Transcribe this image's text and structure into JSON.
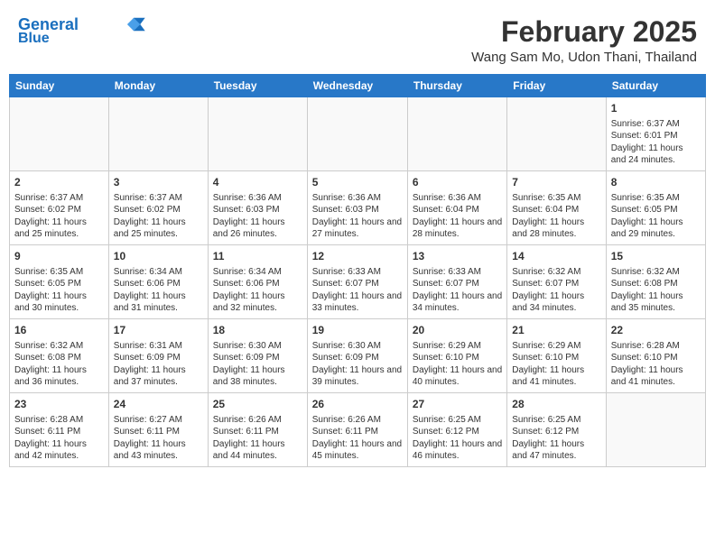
{
  "header": {
    "logo_line1": "General",
    "logo_line2": "Blue",
    "month": "February 2025",
    "location": "Wang Sam Mo, Udon Thani, Thailand"
  },
  "weekdays": [
    "Sunday",
    "Monday",
    "Tuesday",
    "Wednesday",
    "Thursday",
    "Friday",
    "Saturday"
  ],
  "weeks": [
    [
      {
        "day": "",
        "info": ""
      },
      {
        "day": "",
        "info": ""
      },
      {
        "day": "",
        "info": ""
      },
      {
        "day": "",
        "info": ""
      },
      {
        "day": "",
        "info": ""
      },
      {
        "day": "",
        "info": ""
      },
      {
        "day": "1",
        "info": "Sunrise: 6:37 AM\nSunset: 6:01 PM\nDaylight: 11 hours and 24 minutes."
      }
    ],
    [
      {
        "day": "2",
        "info": "Sunrise: 6:37 AM\nSunset: 6:02 PM\nDaylight: 11 hours and 25 minutes."
      },
      {
        "day": "3",
        "info": "Sunrise: 6:37 AM\nSunset: 6:02 PM\nDaylight: 11 hours and 25 minutes."
      },
      {
        "day": "4",
        "info": "Sunrise: 6:36 AM\nSunset: 6:03 PM\nDaylight: 11 hours and 26 minutes."
      },
      {
        "day": "5",
        "info": "Sunrise: 6:36 AM\nSunset: 6:03 PM\nDaylight: 11 hours and 27 minutes."
      },
      {
        "day": "6",
        "info": "Sunrise: 6:36 AM\nSunset: 6:04 PM\nDaylight: 11 hours and 28 minutes."
      },
      {
        "day": "7",
        "info": "Sunrise: 6:35 AM\nSunset: 6:04 PM\nDaylight: 11 hours and 28 minutes."
      },
      {
        "day": "8",
        "info": "Sunrise: 6:35 AM\nSunset: 6:05 PM\nDaylight: 11 hours and 29 minutes."
      }
    ],
    [
      {
        "day": "9",
        "info": "Sunrise: 6:35 AM\nSunset: 6:05 PM\nDaylight: 11 hours and 30 minutes."
      },
      {
        "day": "10",
        "info": "Sunrise: 6:34 AM\nSunset: 6:06 PM\nDaylight: 11 hours and 31 minutes."
      },
      {
        "day": "11",
        "info": "Sunrise: 6:34 AM\nSunset: 6:06 PM\nDaylight: 11 hours and 32 minutes."
      },
      {
        "day": "12",
        "info": "Sunrise: 6:33 AM\nSunset: 6:07 PM\nDaylight: 11 hours and 33 minutes."
      },
      {
        "day": "13",
        "info": "Sunrise: 6:33 AM\nSunset: 6:07 PM\nDaylight: 11 hours and 34 minutes."
      },
      {
        "day": "14",
        "info": "Sunrise: 6:32 AM\nSunset: 6:07 PM\nDaylight: 11 hours and 34 minutes."
      },
      {
        "day": "15",
        "info": "Sunrise: 6:32 AM\nSunset: 6:08 PM\nDaylight: 11 hours and 35 minutes."
      }
    ],
    [
      {
        "day": "16",
        "info": "Sunrise: 6:32 AM\nSunset: 6:08 PM\nDaylight: 11 hours and 36 minutes."
      },
      {
        "day": "17",
        "info": "Sunrise: 6:31 AM\nSunset: 6:09 PM\nDaylight: 11 hours and 37 minutes."
      },
      {
        "day": "18",
        "info": "Sunrise: 6:30 AM\nSunset: 6:09 PM\nDaylight: 11 hours and 38 minutes."
      },
      {
        "day": "19",
        "info": "Sunrise: 6:30 AM\nSunset: 6:09 PM\nDaylight: 11 hours and 39 minutes."
      },
      {
        "day": "20",
        "info": "Sunrise: 6:29 AM\nSunset: 6:10 PM\nDaylight: 11 hours and 40 minutes."
      },
      {
        "day": "21",
        "info": "Sunrise: 6:29 AM\nSunset: 6:10 PM\nDaylight: 11 hours and 41 minutes."
      },
      {
        "day": "22",
        "info": "Sunrise: 6:28 AM\nSunset: 6:10 PM\nDaylight: 11 hours and 41 minutes."
      }
    ],
    [
      {
        "day": "23",
        "info": "Sunrise: 6:28 AM\nSunset: 6:11 PM\nDaylight: 11 hours and 42 minutes."
      },
      {
        "day": "24",
        "info": "Sunrise: 6:27 AM\nSunset: 6:11 PM\nDaylight: 11 hours and 43 minutes."
      },
      {
        "day": "25",
        "info": "Sunrise: 6:26 AM\nSunset: 6:11 PM\nDaylight: 11 hours and 44 minutes."
      },
      {
        "day": "26",
        "info": "Sunrise: 6:26 AM\nSunset: 6:11 PM\nDaylight: 11 hours and 45 minutes."
      },
      {
        "day": "27",
        "info": "Sunrise: 6:25 AM\nSunset: 6:12 PM\nDaylight: 11 hours and 46 minutes."
      },
      {
        "day": "28",
        "info": "Sunrise: 6:25 AM\nSunset: 6:12 PM\nDaylight: 11 hours and 47 minutes."
      },
      {
        "day": "",
        "info": ""
      }
    ]
  ]
}
